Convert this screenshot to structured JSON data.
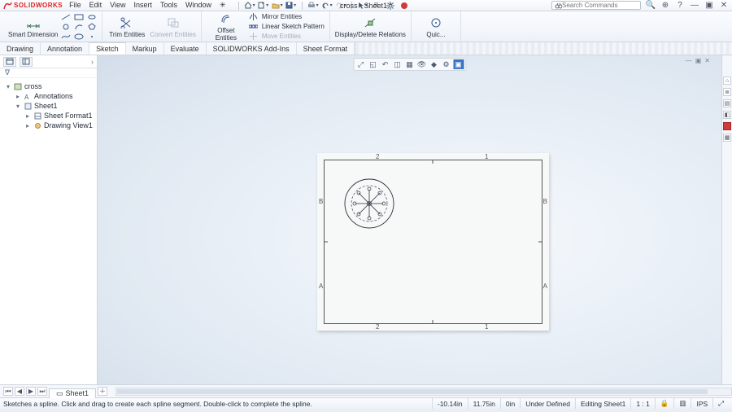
{
  "app": {
    "brand": "SOLIDWORKS",
    "doc_title": "cross - Sheet1 *"
  },
  "menu": {
    "items": [
      "File",
      "Edit",
      "View",
      "Insert",
      "Tools",
      "Window"
    ]
  },
  "search": {
    "placeholder": "Search Commands"
  },
  "ribbon": {
    "smart_dimension": "Smart Dimension",
    "trim_entities": "Trim Entities",
    "convert_entities": "Convert Entities",
    "offset_entities": "Offset\nEntities",
    "mirror_entities": "Mirror Entities",
    "linear_sketch_pattern": "Linear Sketch Pattern",
    "move_entities": "Move Entities",
    "display_delete_relations": "Display/Delete Relations",
    "quick_snaps": "Quic..."
  },
  "cmd_tabs": {
    "items": [
      "Drawing",
      "Annotation",
      "Sketch",
      "Markup",
      "Evaluate",
      "SOLIDWORKS Add-Ins",
      "Sheet Format"
    ],
    "active_index": 2
  },
  "tree": {
    "root": "cross",
    "annotations": "Annotations",
    "sheet": "Sheet1",
    "sheet_format": "Sheet Format1",
    "drawing_view": "Drawing View1"
  },
  "drawing": {
    "zone_top_left": "2",
    "zone_top_right": "1",
    "zone_bottom_left": "2",
    "zone_bottom_right": "1",
    "zone_left_top": "B",
    "zone_left_bottom": "A",
    "zone_right_top": "B",
    "zone_right_bottom": "A"
  },
  "sheet_tabs": {
    "nav": [
      "⏮",
      "◀",
      "▶",
      "⏭"
    ],
    "active": "Sheet1",
    "add": "＋"
  },
  "status": {
    "hint": "Sketches a spline. Click and drag to create each spline segment. Double-click to complete the spline.",
    "coord_x": "-10.14in",
    "coord_y": "11.75in",
    "coord_z": "0in",
    "defined": "Under Defined",
    "context": "Editing Sheet1",
    "scale": "1 : 1",
    "units": "IPS"
  },
  "colors": {
    "brand_red": "#d22",
    "panel": "#f4f7fb"
  },
  "icons": {}
}
